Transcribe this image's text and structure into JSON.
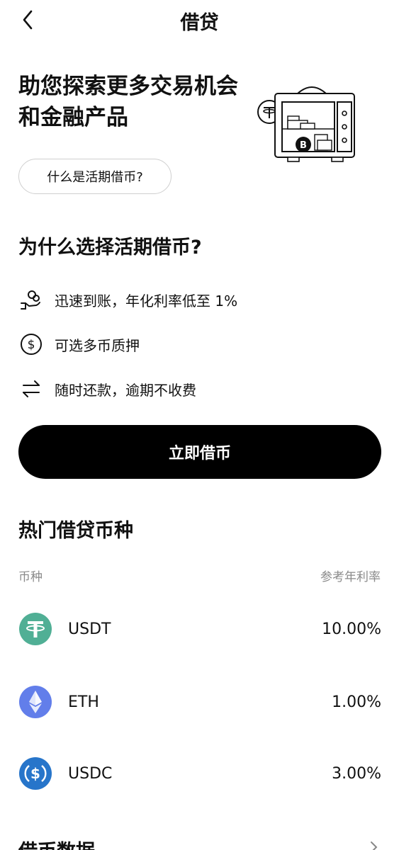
{
  "header": {
    "title": "借贷"
  },
  "hero": {
    "title_line1": "助您探索更多交易机会",
    "title_line2": "和金融产品",
    "what_button": "什么是活期借币?"
  },
  "why": {
    "title": "为什么选择活期借币?",
    "features": [
      {
        "icon": "coins-hand-icon",
        "text": "迅速到账，年化利率低至 1%"
      },
      {
        "icon": "dollar-circle-icon",
        "text": "可选多币质押"
      },
      {
        "icon": "swap-arrows-icon",
        "text": "随时还款，逾期不收费"
      }
    ]
  },
  "cta": {
    "label": "立即借币"
  },
  "hot": {
    "title": "热门借贷币种",
    "col_coin": "币种",
    "col_rate": "参考年利率",
    "rows": [
      {
        "symbol": "USDT",
        "rate": "10.00%",
        "color": "#50AF95"
      },
      {
        "symbol": "ETH",
        "rate": "1.00%",
        "color": "#627EEA"
      },
      {
        "symbol": "USDC",
        "rate": "3.00%",
        "color": "#2775CA"
      }
    ]
  },
  "data_section": {
    "title": "借币数据"
  }
}
